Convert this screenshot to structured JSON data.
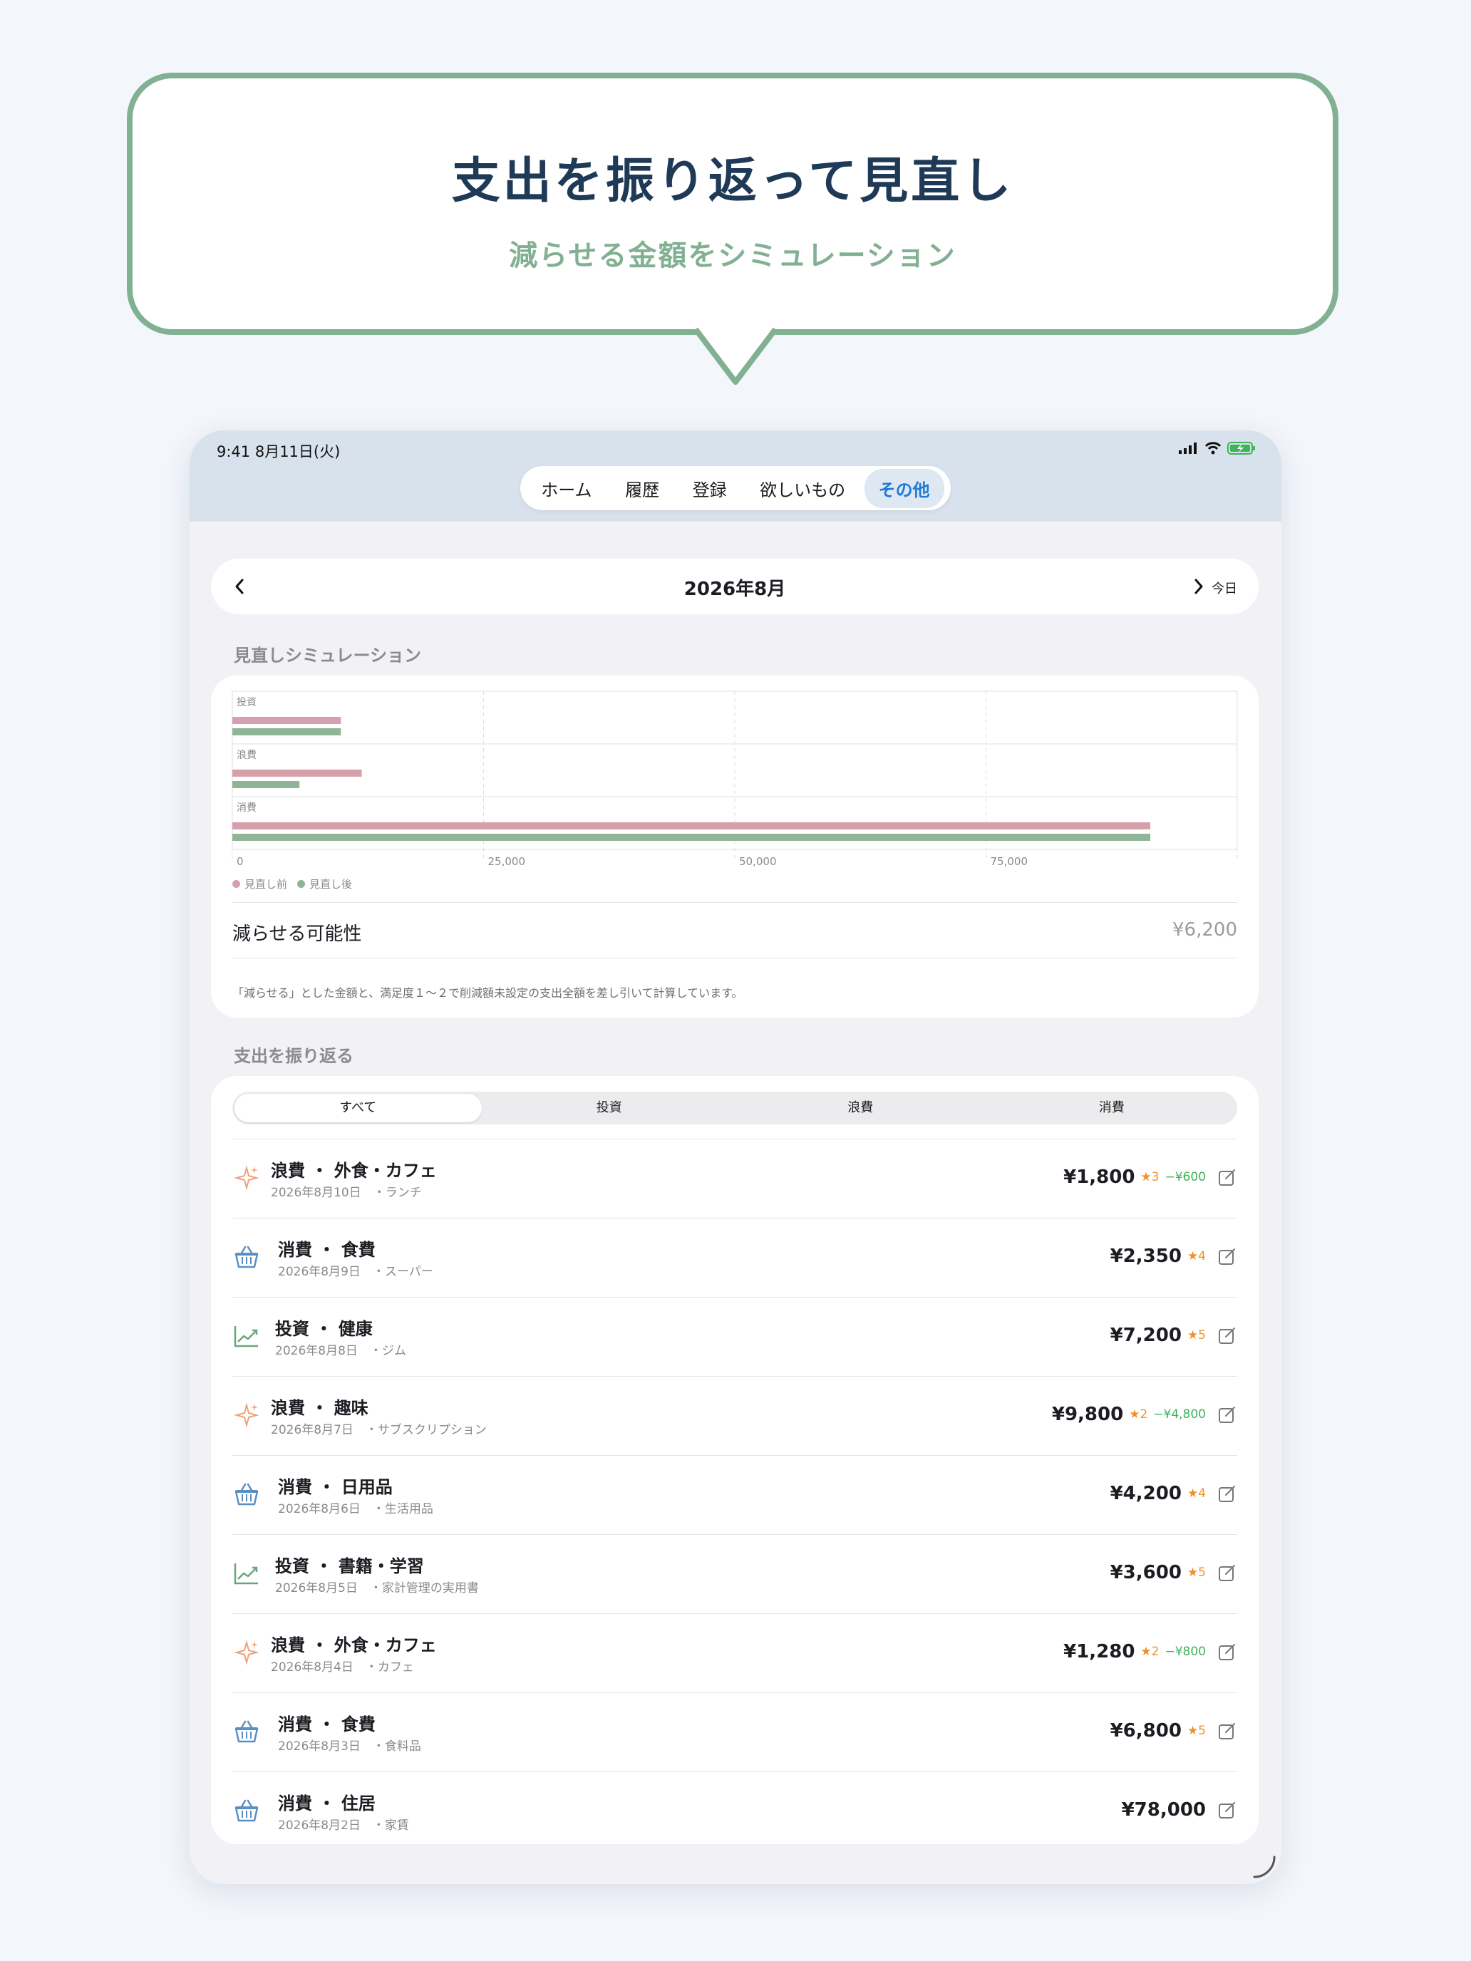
{
  "promo": {
    "headline": "支出を振り返って見直し",
    "subhead": "減らせる金額をシミュレーション"
  },
  "status": {
    "time": "9:41  8月11日(火)"
  },
  "nav": {
    "tabs": [
      "ホーム",
      "履歴",
      "登録",
      "欲しいもの",
      "その他"
    ],
    "active": "その他"
  },
  "month": {
    "title": "2026年8月",
    "today": "今日"
  },
  "simulation": {
    "section_label": "見直しシミュレーション",
    "reduce_label": "減らせる可能性",
    "reduce_value": "¥6,200",
    "note": "「減らせる」とした金額と、満足度１〜２で削減額未設定の支出全額を差し引いて計算しています。"
  },
  "chart_data": {
    "type": "bar",
    "orientation": "horizontal",
    "categories": [
      "投資",
      "浪費",
      "消費"
    ],
    "series": [
      {
        "name": "見直し前",
        "values": [
          10800,
          12880,
          91350
        ]
      },
      {
        "name": "見直し後",
        "values": [
          10800,
          6680,
          91350
        ]
      }
    ],
    "xlim": [
      0,
      100000
    ],
    "x_ticks": [
      "0",
      "25,000",
      "50,000",
      "75,000"
    ],
    "legend_position": "bottom-left",
    "grid": true
  },
  "colors": {
    "before": "#d6a0ab",
    "after": "#8fb597",
    "accent": "#1f7ad8",
    "brand": "#82b092"
  },
  "review": {
    "section_label": "支出を振り返る",
    "segments": [
      "すべて",
      "投資",
      "浪費",
      "消費"
    ],
    "active_segment": "すべて",
    "items": [
      {
        "icon": "sparkle-icon",
        "title": "浪費 ・ 外食・カフェ",
        "sub": "2026年8月10日　・ランチ",
        "amount": "¥1,800",
        "stars": "★3",
        "saving": "−¥600"
      },
      {
        "icon": "basket-icon",
        "title": "消費 ・ 食費",
        "sub": "2026年8月9日　・スーパー",
        "amount": "¥2,350",
        "stars": "★4",
        "saving": ""
      },
      {
        "icon": "trend-up-icon",
        "title": "投資 ・ 健康",
        "sub": "2026年8月8日　・ジム",
        "amount": "¥7,200",
        "stars": "★5",
        "saving": ""
      },
      {
        "icon": "sparkle-icon",
        "title": "浪費 ・ 趣味",
        "sub": "2026年8月7日　・サブスクリプション",
        "amount": "¥9,800",
        "stars": "★2",
        "saving": "−¥4,800"
      },
      {
        "icon": "basket-icon",
        "title": "消費 ・ 日用品",
        "sub": "2026年8月6日　・生活用品",
        "amount": "¥4,200",
        "stars": "★4",
        "saving": ""
      },
      {
        "icon": "trend-up-icon",
        "title": "投資 ・ 書籍・学習",
        "sub": "2026年8月5日　・家計管理の実用書",
        "amount": "¥3,600",
        "stars": "★5",
        "saving": ""
      },
      {
        "icon": "sparkle-icon",
        "title": "浪費 ・ 外食・カフェ",
        "sub": "2026年8月4日　・カフェ",
        "amount": "¥1,280",
        "stars": "★2",
        "saving": "−¥800"
      },
      {
        "icon": "basket-icon",
        "title": "消費 ・ 食費",
        "sub": "2026年8月3日　・食料品",
        "amount": "¥6,800",
        "stars": "★5",
        "saving": ""
      },
      {
        "icon": "basket-icon",
        "title": "消費 ・ 住居",
        "sub": "2026年8月2日　・家賃",
        "amount": "¥78,000",
        "stars": "",
        "saving": ""
      }
    ]
  }
}
